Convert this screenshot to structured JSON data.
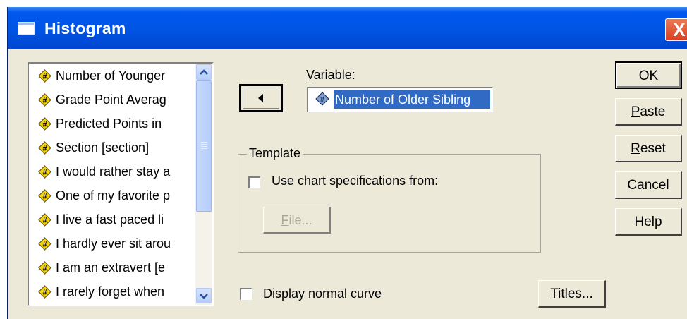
{
  "window": {
    "title": "Histogram",
    "close_glyph": "X"
  },
  "variable_list": {
    "items": [
      "Number of Younger",
      "Grade Point Averag",
      "Predicted Points in",
      "Section [section]",
      "I would rather stay a",
      "One of my favorite p",
      "I live a fast paced li",
      "I hardly ever sit arou",
      "I am an extravert [e",
      "I rarely forget when"
    ],
    "item_icon": "scale-variable-icon"
  },
  "move_button": {
    "icon": "arrow-left-icon"
  },
  "variable": {
    "label": "Variable:",
    "value": "Number of Older Sibling"
  },
  "template": {
    "title": "Template",
    "checkbox_label": "Use chart specifications from:",
    "checked": false,
    "file_button": "File..."
  },
  "normal_curve": {
    "label": "Display normal curve",
    "checked": false
  },
  "buttons": {
    "ok": "OK",
    "paste": "Paste",
    "reset": "Reset",
    "cancel": "Cancel",
    "help": "Help",
    "titles": "Titles..."
  },
  "colors": {
    "titlebar": "#0054e3",
    "dialog_bg": "#ece9d8",
    "selection": "#316ac5",
    "variable_icon": "#f5d400"
  }
}
